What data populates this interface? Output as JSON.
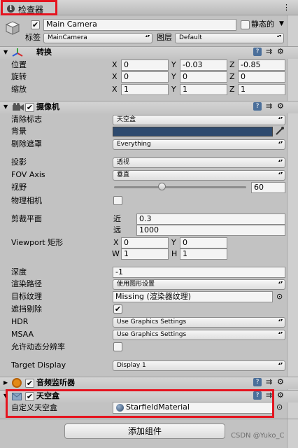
{
  "tab": {
    "label": "检查器"
  },
  "object": {
    "name": "Main Camera",
    "static_label": "静态的",
    "tag_label": "标签",
    "tag_value": "MainCamera",
    "layer_label": "图层",
    "layer_value": "Default"
  },
  "transform": {
    "title": "转换",
    "position_label": "位置",
    "rotation_label": "旋转",
    "scale_label": "缩放",
    "position": {
      "x": "0",
      "y": "-0.03",
      "z": "-0.85"
    },
    "rotation": {
      "x": "0",
      "y": "0",
      "z": "0"
    },
    "scale": {
      "x": "1",
      "y": "1",
      "z": "1"
    },
    "x_label": "X",
    "y_label": "Y",
    "z_label": "Z"
  },
  "camera": {
    "title": "摄像机",
    "clear_flags_label": "清除标志",
    "clear_flags_value": "天空盒",
    "background_label": "背景",
    "background_color": "#2e4a6e",
    "culling_label": "剔除遮罩",
    "culling_value": "Everything",
    "projection_label": "投影",
    "projection_value": "透视",
    "fov_axis_label": "FOV Axis",
    "fov_axis_value": "垂直",
    "fov_label": "视野",
    "fov_value": "60",
    "fov_fraction": 0.36,
    "physical_label": "物理相机",
    "clipping_label": "剪裁平面",
    "near_label": "近",
    "near_value": "0.3",
    "far_label": "远",
    "far_value": "1000",
    "viewport_label": "Viewport 矩形",
    "viewport": {
      "x_label": "X",
      "x": "0",
      "y_label": "Y",
      "y": "0",
      "w_label": "W",
      "w": "1",
      "h_label": "H",
      "h": "1"
    },
    "depth_label": "深度",
    "depth_value": "-1",
    "render_path_label": "渲染路径",
    "render_path_value": "使用图形设置",
    "target_texture_label": "目标纹理",
    "target_texture_value": "Missing (渲染器纹理)",
    "occlusion_label": "遮挡剔除",
    "hdr_label": "HDR",
    "hdr_value": "Use Graphics Settings",
    "msaa_label": "MSAA",
    "msaa_value": "Use Graphics Settings",
    "dynamic_res_label": "允许动态分辨率",
    "target_display_label": "Target Display",
    "target_display_value": "Display 1"
  },
  "audio_listener": {
    "title": "音频监听器"
  },
  "skybox": {
    "title": "天空盒",
    "custom_label": "自定义天空盒",
    "material_value": "StarfieldMaterial"
  },
  "add_component_label": "添加组件",
  "watermark": "CSDN @Yuko_C",
  "colors": {
    "red_highlight": "#e5141f",
    "panel": "#c2c2c2"
  }
}
